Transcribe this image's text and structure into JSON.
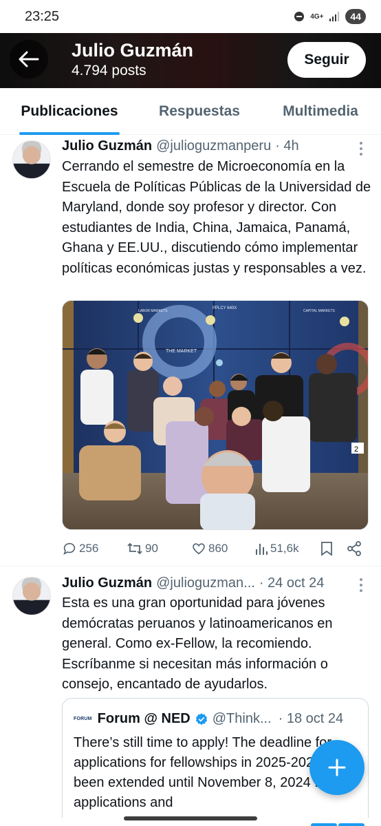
{
  "status_bar": {
    "time": "23:25",
    "network": "4G+",
    "battery": "44"
  },
  "header": {
    "name": "Julio Guzmán",
    "posts": "4.794 posts",
    "follow_label": "Seguir"
  },
  "tabs": [
    {
      "label": "Publicaciones",
      "active": true
    },
    {
      "label": "Respuestas",
      "active": false
    },
    {
      "label": "Multimedia",
      "active": false
    }
  ],
  "posts": [
    {
      "name": "Julio Guzmán",
      "handle": "@julioguzmanperu",
      "time": "· 4h",
      "text": "Cerrando el semestre de Microeconomía en la Escuela de Políticas Públicas de la Universidad de Maryland, donde soy profesor y director. Con estudiantes de India, China, Jamaica, Panamá, Ghana y EE.UU., discutiendo cómo implementar políticas económicas justas y responsables a vez.",
      "photo_screen_labels": [
        "THE MARKET",
        "PPLCY 640X",
        "LABOR MARKETS",
        "CAPITAL MARKETS"
      ],
      "stats": {
        "replies": "256",
        "reposts": "90",
        "likes": "860",
        "views": "51,6k"
      }
    },
    {
      "name": "Julio Guzmán",
      "handle": "@julioguzman...",
      "time": "· 24 oct 24",
      "text": "Esta es una gran oportunidad para jóvenes demócratas peruanos y latinoamericanos en general. Como ex-Fellow, la recomiendo. Escríbanme si necesitan más información o consejo, encantado de ayudarlos.",
      "quote": {
        "logo": "FORUM",
        "name": "Forum @ NED",
        "handle": "@Think...",
        "time": "· 18 oct 24",
        "text": "There’s still time to apply! The deadline for applications for fellowships in 2025-2026 has been extended until November 8, 2024 for applications and"
      }
    }
  ],
  "colors": {
    "accent": "#1d9bf0",
    "text": "#0f1419",
    "muted": "#536471"
  },
  "icons": [
    "back-arrow-icon",
    "more-icon",
    "reply-icon",
    "repost-icon",
    "like-icon",
    "views-icon",
    "bookmark-icon",
    "share-icon",
    "verified-icon",
    "plus-icon"
  ]
}
